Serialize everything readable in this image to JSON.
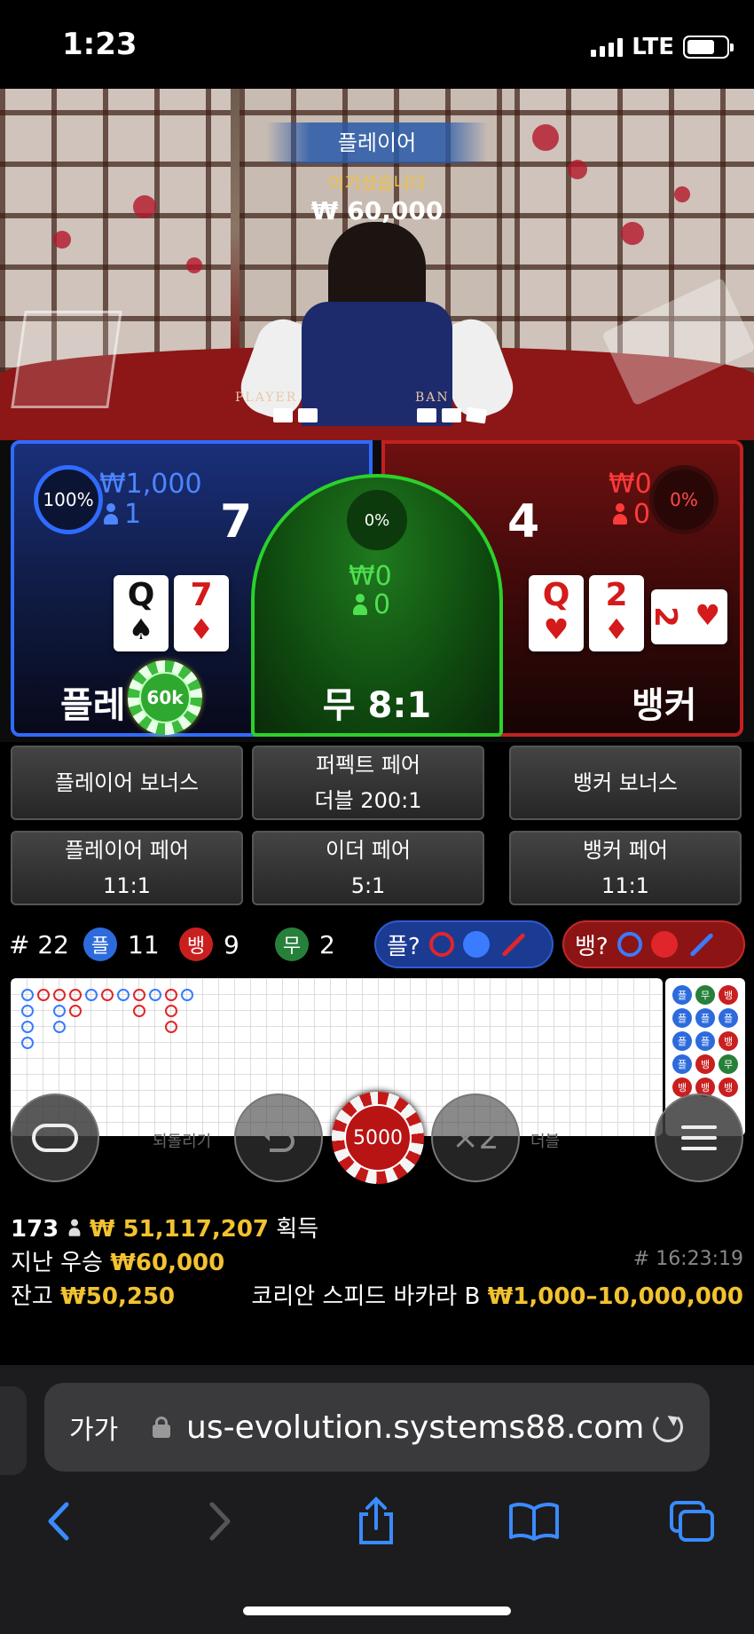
{
  "status_bar": {
    "time": "1:23",
    "network": "LTE",
    "battery_level": 0.72
  },
  "video": {
    "result_label": "플레이어",
    "result_message": "이기셨습니다",
    "result_amount": "₩ 60,000",
    "table_player_text": "PLAYER",
    "table_banker_text": "BAN"
  },
  "player": {
    "percent": "100%",
    "amount": "₩1,000",
    "players": "1",
    "score": "7",
    "cards": [
      {
        "rank": "Q",
        "suit": "♠",
        "color": "black"
      },
      {
        "rank": "7",
        "suit": "♦",
        "color": "red"
      }
    ],
    "label": "플레이어",
    "chip": "60k"
  },
  "tie": {
    "percent": "0%",
    "amount": "₩0",
    "players": "0",
    "label": "무 8:1"
  },
  "banker": {
    "percent": "0%",
    "amount": "₩0",
    "players": "0",
    "score": "4",
    "cards": [
      {
        "rank": "Q",
        "suit": "♥",
        "color": "red"
      },
      {
        "rank": "2",
        "suit": "♦",
        "color": "red"
      },
      {
        "rank": "2",
        "suit": "♥",
        "color": "red"
      }
    ],
    "label": "뱅커"
  },
  "side_bets": {
    "player_bonus": "플레이어 보너스",
    "perfect_pair_line1": "퍼펙트 페어",
    "perfect_pair_line2": "더블 200:1",
    "banker_bonus": "뱅커 보너스",
    "player_pair_line1": "플레이어 페어",
    "player_pair_line2": "11:1",
    "either_pair_line1": "이더 페어",
    "either_pair_line2": "5:1",
    "banker_pair_line1": "뱅커 페어",
    "banker_pair_line2": "11:1"
  },
  "stats": {
    "rounds": "# 22",
    "player_badge": "플",
    "player_count": "11",
    "banker_badge": "뱅",
    "banker_count": "9",
    "tie_badge": "무",
    "tie_count": "2",
    "predict_player": "플?",
    "predict_banker": "뱅?"
  },
  "controls": {
    "left_label": "되돌리기",
    "right_label": "더블",
    "chip_value": "5000",
    "double_icon": "×2"
  },
  "info": {
    "players_online": "173",
    "total_won": "₩ 51,117,207",
    "total_won_suffix": "획득",
    "last_win_label": "지난 우승",
    "last_win_amount": "₩60,000",
    "round_time": "# 16:23:19",
    "balance_label": "잔고",
    "balance_amount": "₩50,250",
    "table_name": "코리안 스피드 바카라 B",
    "limits": "₩1,000–10,000,000"
  },
  "browser": {
    "text_size_label": "가가",
    "url": "us-evolution.systems88.com"
  },
  "colors": {
    "player": "#2f6bff",
    "banker": "#c22121",
    "tie": "#2bd12b",
    "gold": "#f2c230"
  }
}
